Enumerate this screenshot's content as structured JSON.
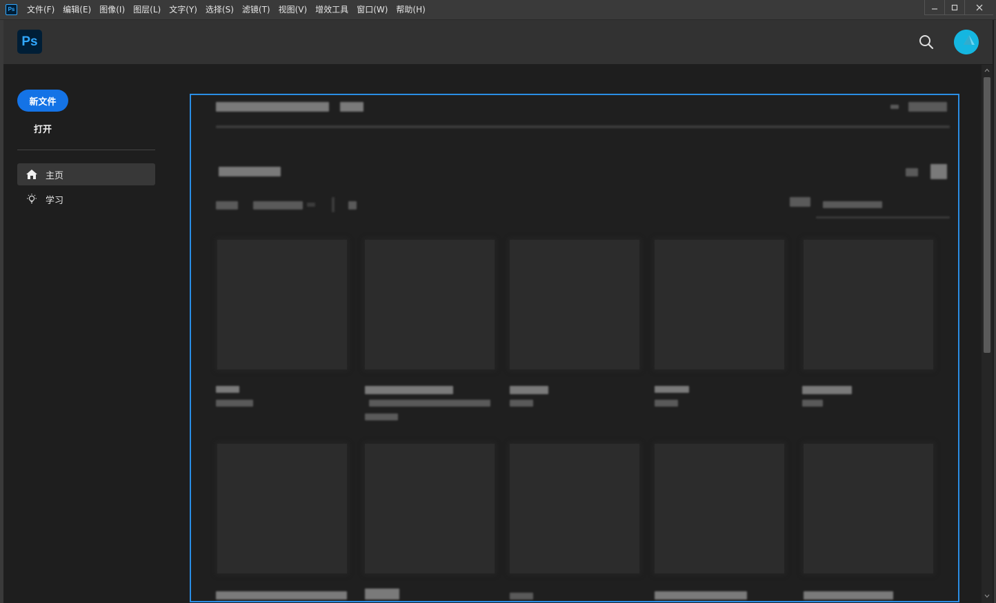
{
  "menubar": {
    "app_icon_text": "Ps",
    "items": [
      {
        "label": "文件(F)"
      },
      {
        "label": "编辑(E)"
      },
      {
        "label": "图像(I)"
      },
      {
        "label": "图层(L)"
      },
      {
        "label": "文字(Y)"
      },
      {
        "label": "选择(S)"
      },
      {
        "label": "滤镜(T)"
      },
      {
        "label": "视图(V)"
      },
      {
        "label": "增效工具"
      },
      {
        "label": "窗口(W)"
      },
      {
        "label": "帮助(H)"
      }
    ]
  },
  "header": {
    "logo_text": "Ps",
    "search_icon": "search-icon",
    "avatar_color": "#15b6e0"
  },
  "sidebar": {
    "new_file_label": "新文件",
    "open_label": "打开",
    "nav": [
      {
        "label": "主页",
        "icon": "home-icon",
        "active": true
      },
      {
        "label": "学习",
        "icon": "lightbulb-icon",
        "active": false
      }
    ]
  },
  "colors": {
    "accent": "#1473e6",
    "selection_border": "#2a8ee6",
    "brand_dark": "#001e36",
    "brand_light": "#31a8ff"
  }
}
